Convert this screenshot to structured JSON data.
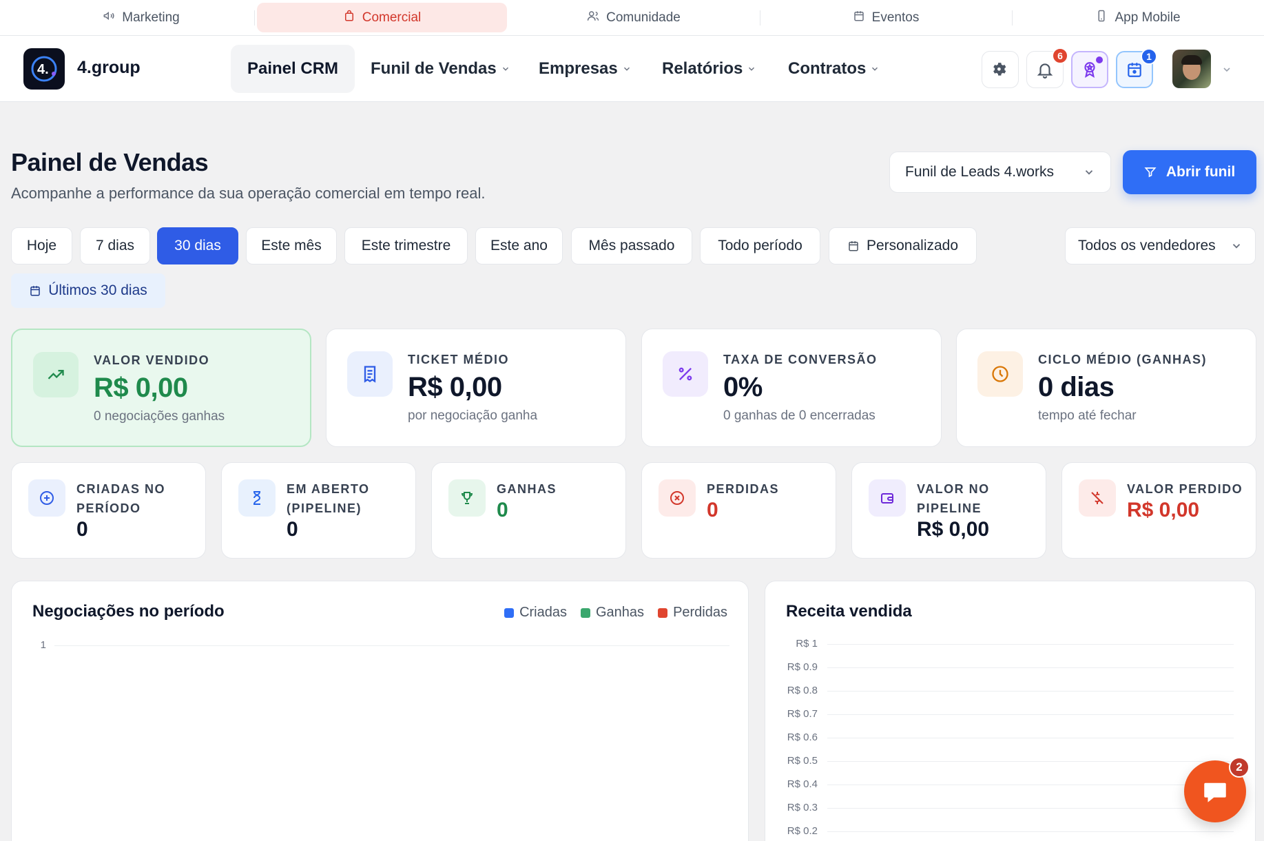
{
  "modules": [
    {
      "label": "Marketing",
      "icon": "megaphone-icon"
    },
    {
      "label": "Comercial",
      "icon": "bag-icon",
      "active": true
    },
    {
      "label": "Comunidade",
      "icon": "users-icon"
    },
    {
      "label": "Eventos",
      "icon": "calendar-icon"
    },
    {
      "label": "App Mobile",
      "icon": "phone-icon"
    }
  ],
  "brand": {
    "name": "4.group",
    "logo_text": "4."
  },
  "nav": {
    "items": [
      {
        "label": "Painel CRM",
        "active": true
      },
      {
        "label": "Funil de Vendas"
      },
      {
        "label": "Empresas"
      },
      {
        "label": "Relatórios"
      },
      {
        "label": "Contratos"
      }
    ]
  },
  "header_actions": {
    "notifications_badge": "6",
    "calendar_badge": "1"
  },
  "page": {
    "title": "Painel de Vendas",
    "subtitle": "Acompanhe a performance da sua operação comercial em tempo real.",
    "funnel_select": "Funil de Leads 4.works",
    "open_funnel_button": "Abrir funil"
  },
  "filters": {
    "periods": [
      "Hoje",
      "7 dias",
      "30 dias",
      "Este mês",
      "Este trimestre",
      "Este ano",
      "Mês passado",
      "Todo período",
      "Personalizado"
    ],
    "active_period": "30 dias",
    "vendors": "Todos os vendedores",
    "range_label": "Últimos 30 dias"
  },
  "kpis": [
    {
      "label": "VALOR VENDIDO",
      "value": "R$ 0,00",
      "note": "0 negociações ganhas",
      "icon": "trending-up-icon"
    },
    {
      "label": "TICKET MÉDIO",
      "value": "R$ 0,00",
      "note": "por negociação ganha",
      "icon": "receipt-icon"
    },
    {
      "label": "TAXA DE CONVERSÃO",
      "value": "0%",
      "note": "0 ganhas de 0 encerradas",
      "icon": "percent-icon"
    },
    {
      "label": "CICLO MÉDIO (GANHAS)",
      "value": "0 dias",
      "note": "tempo até fechar",
      "icon": "clock-icon"
    }
  ],
  "stats": [
    {
      "label": "CRIADAS NO PERÍODO",
      "value": "0",
      "icon": "plus-circle-icon"
    },
    {
      "label": "EM ABERTO (PIPELINE)",
      "value": "0",
      "icon": "hourglass-icon"
    },
    {
      "label": "GANHAS",
      "value": "0",
      "icon": "trophy-icon"
    },
    {
      "label": "PERDIDAS",
      "value": "0",
      "icon": "x-circle-icon"
    },
    {
      "label": "VALOR NO PIPELINE",
      "value": "R$ 0,00",
      "icon": "wallet-icon"
    },
    {
      "label": "VALOR PERDIDO",
      "value": "R$ 0,00",
      "icon": "money-off-icon"
    }
  ],
  "colors": {
    "primary": "#2f6ef6",
    "success": "#1f8a4c",
    "danger": "#d2372b",
    "series_created": "#2f6ef6",
    "series_won": "#3aa76d",
    "series_lost": "#e0452f"
  },
  "chat": {
    "badge": "2"
  },
  "chart_data": [
    {
      "type": "bar",
      "title": "Negociações no período",
      "series": [
        {
          "name": "Criadas",
          "values": []
        },
        {
          "name": "Ganhas",
          "values": []
        },
        {
          "name": "Perdidas",
          "values": []
        }
      ],
      "categories": [],
      "y_ticks": [
        "1"
      ],
      "legend": "top-right",
      "grid": true
    },
    {
      "type": "bar",
      "title": "Receita vendida",
      "series": [],
      "categories": [],
      "y_ticks": [
        "R$ 1",
        "R$ 0.9",
        "R$ 0.8",
        "R$ 0.7",
        "R$ 0.6",
        "R$ 0.5",
        "R$ 0.4",
        "R$ 0.3",
        "R$ 0.2"
      ],
      "ylim": [
        0,
        1
      ],
      "grid": true
    }
  ]
}
